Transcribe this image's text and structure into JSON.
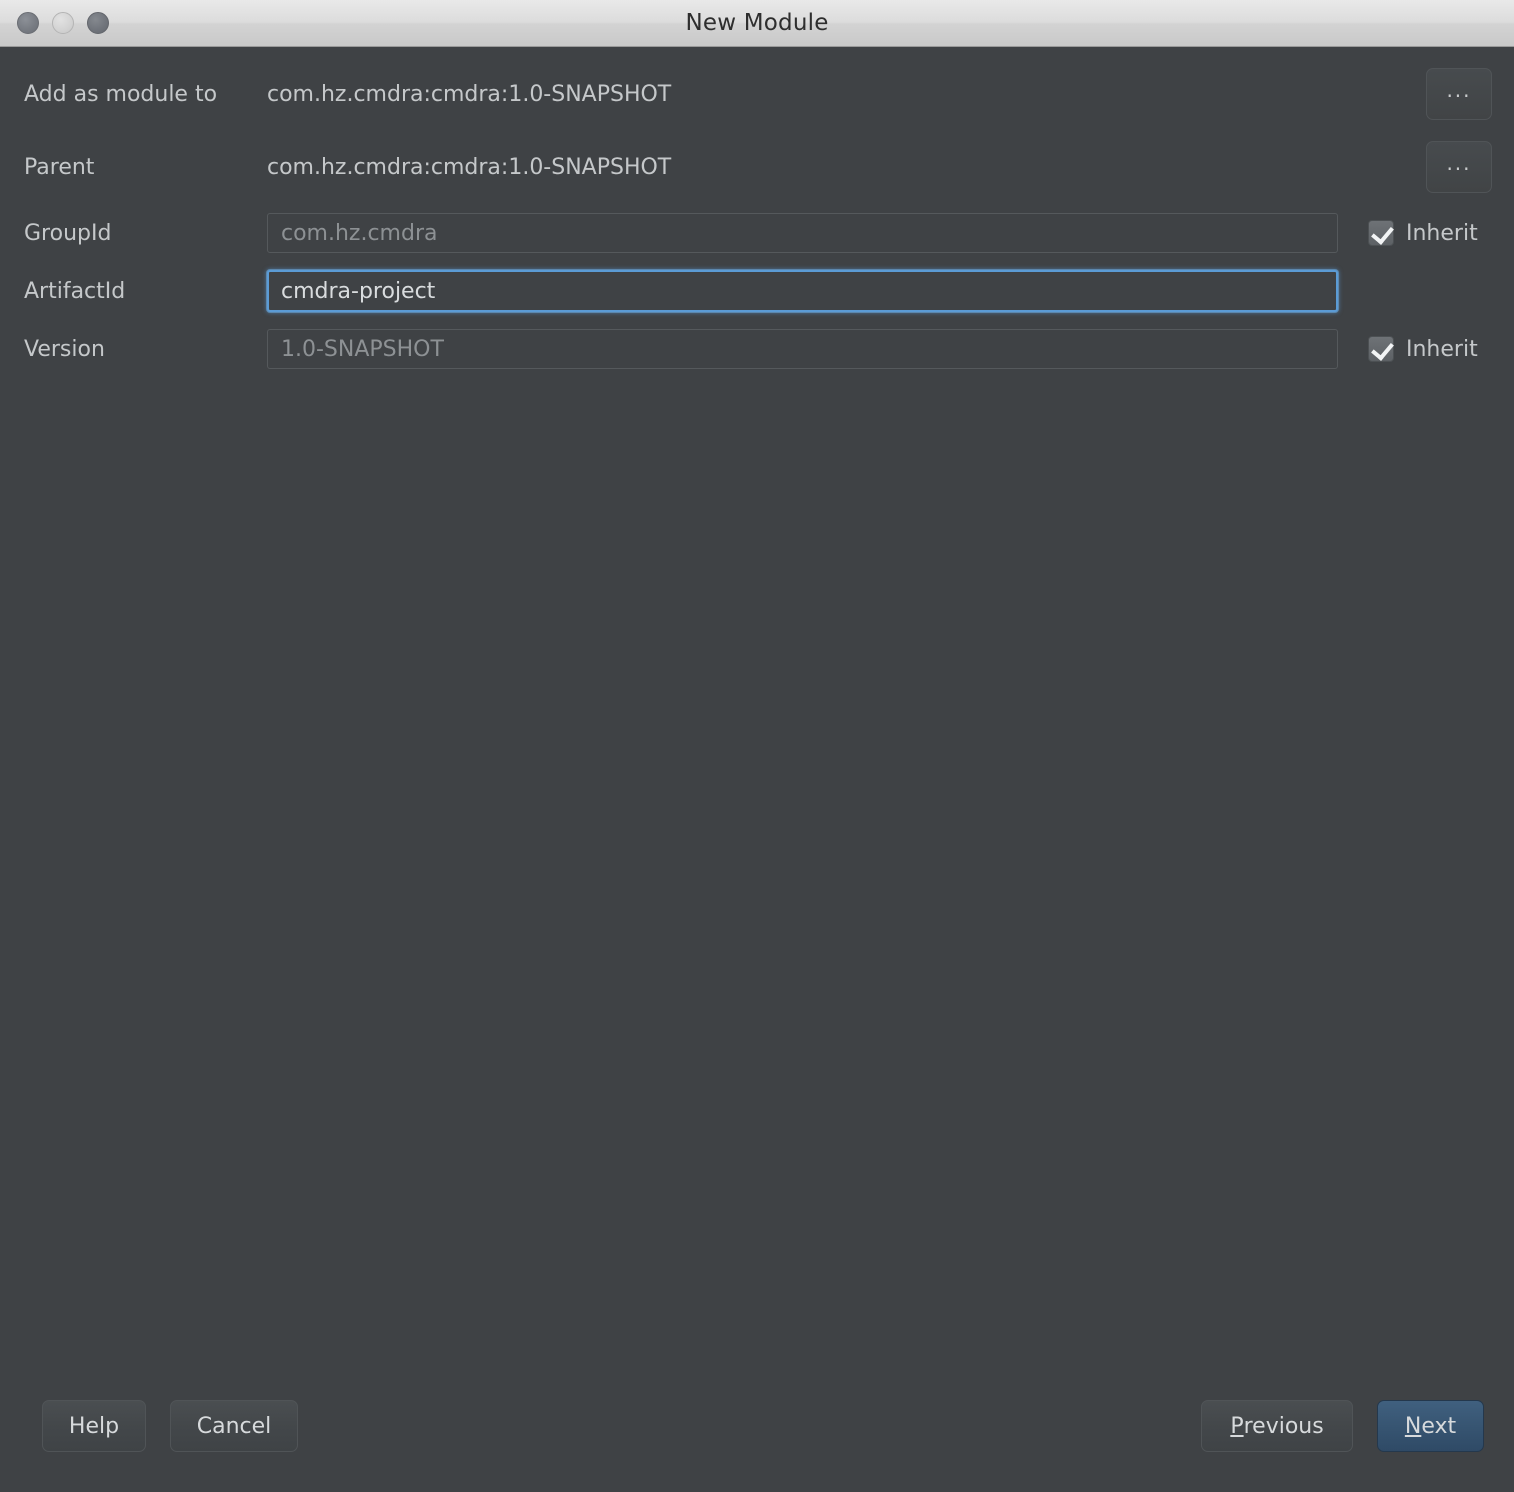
{
  "window": {
    "title": "New Module",
    "traffic_lights": [
      "close-button",
      "minimize-button",
      "maximize-button"
    ]
  },
  "form": {
    "rows": [
      {
        "label": "Add as module to",
        "value": "com.hz.cmdra:cmdra:1.0-SNAPSHOT",
        "browse_label": "...",
        "type": "static"
      },
      {
        "label": "Parent",
        "value": "com.hz.cmdra:cmdra:1.0-SNAPSHOT",
        "browse_label": "...",
        "type": "static"
      },
      {
        "label": "GroupId",
        "value": "com.hz.cmdra",
        "inherit_label": "Inherit",
        "inherit_checked": true,
        "focused": false,
        "type": "input"
      },
      {
        "label": "ArtifactId",
        "value": "cmdra-project",
        "inherit_label": "",
        "inherit_checked": false,
        "focused": true,
        "type": "input"
      },
      {
        "label": "Version",
        "value": "1.0-SNAPSHOT",
        "inherit_label": "Inherit",
        "inherit_checked": true,
        "focused": false,
        "type": "input"
      }
    ]
  },
  "footer": {
    "help_label": "Help",
    "cancel_label": "Cancel",
    "previous_mnemonic": "P",
    "previous_rest": "revious",
    "next_mnemonic": "N",
    "next_rest": "ext"
  },
  "colors": {
    "background": "#3f4245",
    "titlebar": "#dcdcdc",
    "focus_border": "#5b9bd5",
    "default_button": "#375572",
    "text": "#c5c8ca",
    "muted_text": "#8d9194"
  }
}
